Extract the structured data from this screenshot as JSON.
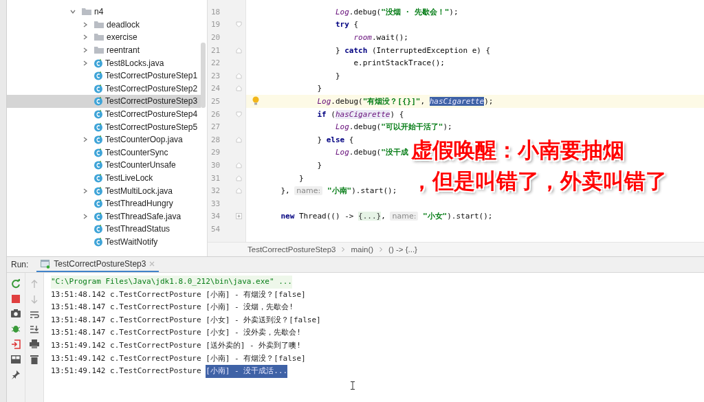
{
  "project_tree": [
    {
      "label": "n4",
      "kind": "folder",
      "expandable": true,
      "expanded": true,
      "selected": false,
      "children": [
        {
          "label": "deadlock",
          "kind": "folder",
          "expandable": true,
          "expanded": false,
          "selected": false
        },
        {
          "label": "exercise",
          "kind": "folder",
          "expandable": true,
          "expanded": false,
          "selected": false
        },
        {
          "label": "reentrant",
          "kind": "folder",
          "expandable": true,
          "expanded": false,
          "selected": false
        },
        {
          "label": "Test8Locks.java",
          "kind": "class",
          "expandable": true,
          "expanded": false,
          "selected": false
        },
        {
          "label": "TestCorrectPostureStep1",
          "kind": "class",
          "expandable": false,
          "selected": false
        },
        {
          "label": "TestCorrectPostureStep2",
          "kind": "class",
          "expandable": false,
          "selected": false
        },
        {
          "label": "TestCorrectPostureStep3",
          "kind": "class",
          "expandable": false,
          "selected": true
        },
        {
          "label": "TestCorrectPostureStep4",
          "kind": "class",
          "expandable": false,
          "selected": false
        },
        {
          "label": "TestCorrectPostureStep5",
          "kind": "class",
          "expandable": false,
          "selected": false
        },
        {
          "label": "TestCounterOop.java",
          "kind": "class",
          "expandable": true,
          "expanded": false,
          "selected": false
        },
        {
          "label": "TestCounterSync",
          "kind": "class",
          "expandable": false,
          "selected": false
        },
        {
          "label": "TestCounterUnsafe",
          "kind": "class",
          "expandable": false,
          "selected": false
        },
        {
          "label": "TestLiveLock",
          "kind": "class",
          "expandable": false,
          "selected": false
        },
        {
          "label": "TestMultiLock.java",
          "kind": "class",
          "expandable": true,
          "expanded": false,
          "selected": false
        },
        {
          "label": "TestThreadHungry",
          "kind": "class",
          "expandable": false,
          "selected": false
        },
        {
          "label": "TestThreadSafe.java",
          "kind": "class",
          "expandable": true,
          "expanded": false,
          "selected": false
        },
        {
          "label": "TestThreadStatus",
          "kind": "class",
          "expandable": false,
          "selected": false
        },
        {
          "label": "TestWaitNotify",
          "kind": "class",
          "expandable": false,
          "selected": false
        }
      ]
    }
  ],
  "editor": {
    "lines": [
      {
        "number": "18",
        "current": false,
        "kind": "plain",
        "segments": [
          {
            "text": "                Log",
            "kind": "field"
          },
          {
            "text": ".debug(",
            "kind": "plain"
          },
          {
            "text": "\"没烟 · 先歇会！\"",
            "kind": "string"
          },
          {
            "text": ");",
            "kind": "plain"
          }
        ]
      },
      {
        "number": "19",
        "current": false,
        "kind": "fold-start",
        "segments": [
          {
            "text": "                try",
            "kind": "keyword"
          },
          {
            "text": " {",
            "kind": "plain"
          }
        ]
      },
      {
        "number": "20",
        "current": false,
        "kind": "plain",
        "segments": [
          {
            "text": "                    room",
            "kind": "field"
          },
          {
            "text": ".wait();",
            "kind": "plain"
          }
        ]
      },
      {
        "number": "21",
        "current": false,
        "kind": "fold-end",
        "segments": [
          {
            "text": "                } ",
            "kind": "plain"
          },
          {
            "text": "catch",
            "kind": "keyword"
          },
          {
            "text": " (InterruptedException e) {",
            "kind": "plain"
          }
        ]
      },
      {
        "number": "22",
        "current": false,
        "kind": "plain",
        "segments": [
          {
            "text": "                    e.printStackTrace();",
            "kind": "plain"
          }
        ]
      },
      {
        "number": "23",
        "current": false,
        "kind": "fold-end",
        "segments": [
          {
            "text": "                }",
            "kind": "plain"
          }
        ]
      },
      {
        "number": "24",
        "current": false,
        "kind": "fold-end",
        "segments": [
          {
            "text": "            }",
            "kind": "plain"
          }
        ]
      },
      {
        "number": "25",
        "current": true,
        "kind": "plain",
        "segments": [
          {
            "text": "            Log",
            "kind": "field"
          },
          {
            "text": ".debug(",
            "kind": "plain"
          },
          {
            "text": "\"有烟没？[{}]\"",
            "kind": "string"
          },
          {
            "text": ", ",
            "kind": "plain"
          },
          {
            "text": "hasCigarette",
            "kind": "selected"
          },
          {
            "text": ");",
            "kind": "plain"
          }
        ]
      },
      {
        "number": "26",
        "current": false,
        "kind": "fold-start",
        "segments": [
          {
            "text": "            if",
            "kind": "keyword"
          },
          {
            "text": " (",
            "kind": "plain"
          },
          {
            "text": "hasCigarette",
            "kind": "match"
          },
          {
            "text": ") {",
            "kind": "plain"
          }
        ]
      },
      {
        "number": "27",
        "current": false,
        "kind": "plain",
        "segments": [
          {
            "text": "                Log",
            "kind": "field"
          },
          {
            "text": ".debug(",
            "kind": "plain"
          },
          {
            "text": "\"可以开始干活了\"",
            "kind": "string"
          },
          {
            "text": ");",
            "kind": "plain"
          }
        ]
      },
      {
        "number": "28",
        "current": false,
        "kind": "fold-end",
        "segments": [
          {
            "text": "            } ",
            "kind": "plain"
          },
          {
            "text": "else",
            "kind": "keyword"
          },
          {
            "text": " {",
            "kind": "plain"
          }
        ]
      },
      {
        "number": "29",
        "current": false,
        "kind": "plain",
        "segments": [
          {
            "text": "                Log",
            "kind": "field"
          },
          {
            "text": ".debug(",
            "kind": "plain"
          },
          {
            "text": "\"没干成",
            "kind": "string"
          }
        ]
      },
      {
        "number": "30",
        "current": false,
        "kind": "fold-end",
        "segments": [
          {
            "text": "            }",
            "kind": "plain"
          }
        ]
      },
      {
        "number": "31",
        "current": false,
        "kind": "fold-end",
        "segments": [
          {
            "text": "        }",
            "kind": "plain"
          }
        ]
      },
      {
        "number": "32",
        "current": false,
        "kind": "fold-end",
        "segments": [
          {
            "text": "    }, ",
            "kind": "plain"
          },
          {
            "text": "name:",
            "kind": "hint"
          },
          {
            "text": " \"小南\"",
            "kind": "string"
          },
          {
            "text": ").start();",
            "kind": "plain"
          }
        ]
      },
      {
        "number": "33",
        "current": false,
        "kind": "plain"
      },
      {
        "number": "34",
        "current": false,
        "kind": "collapsed",
        "segments": [
          {
            "text": "    new",
            "kind": "keyword"
          },
          {
            "text": " Thread(() -> ",
            "kind": "plain"
          },
          {
            "text": "{...}",
            "kind": "folded"
          },
          {
            "text": ", ",
            "kind": "plain"
          },
          {
            "text": "name:",
            "kind": "hint"
          },
          {
            "text": " \"小女\"",
            "kind": "string"
          },
          {
            "text": ").start();",
            "kind": "plain"
          }
        ]
      },
      {
        "number": "54",
        "current": false,
        "kind": "plain"
      }
    ],
    "breadcrumb": [
      "TestCorrectPostureStep3",
      "main()",
      "() -> {...}"
    ]
  },
  "caption": [
    "虚假唤醒：小南要抽烟",
    "，但是叫错了，外卖叫错了"
  ],
  "run": {
    "label": "Run:",
    "tabs": [
      {
        "label": "TestCorrectPostureStep3",
        "selected": true
      }
    ],
    "console": [
      {
        "kind": "command",
        "segments": [
          {
            "text": "\"C:\\Program Files\\Java\\jdk1.8.0_212\\bin\\java.exe\" ...",
            "selected": false
          }
        ]
      },
      {
        "kind": "log",
        "segments": [
          {
            "text": "13:51:48.142 c.TestCorrectPosture [小南] - 有烟没？[false]",
            "selected": false
          }
        ]
      },
      {
        "kind": "log",
        "segments": [
          {
            "text": "13:51:48.147 c.TestCorrectPosture [小南] - 没烟，先歇会!",
            "selected": false
          }
        ]
      },
      {
        "kind": "log",
        "segments": [
          {
            "text": "13:51:48.147 c.TestCorrectPosture [小女] - 外卖送到没？[false]",
            "selected": false
          }
        ]
      },
      {
        "kind": "log",
        "segments": [
          {
            "text": "13:51:48.147 c.TestCorrectPosture [小女] - 没外卖，先歇会!",
            "selected": false
          }
        ]
      },
      {
        "kind": "log",
        "segments": [
          {
            "text": "13:51:49.142 c.TestCorrectPosture [送外卖的] - 外卖到了噢!",
            "selected": false
          }
        ]
      },
      {
        "kind": "log",
        "segments": [
          {
            "text": "13:51:49.142 c.TestCorrectPosture [小南] - 有烟没？[false]",
            "selected": false
          }
        ]
      },
      {
        "kind": "log",
        "segments": [
          {
            "text": "13:51:49.142 c.TestCorrectPosture",
            "selected": false
          },
          {
            "text": "[小南] - 没干成活...",
            "selected": true
          }
        ]
      }
    ]
  }
}
